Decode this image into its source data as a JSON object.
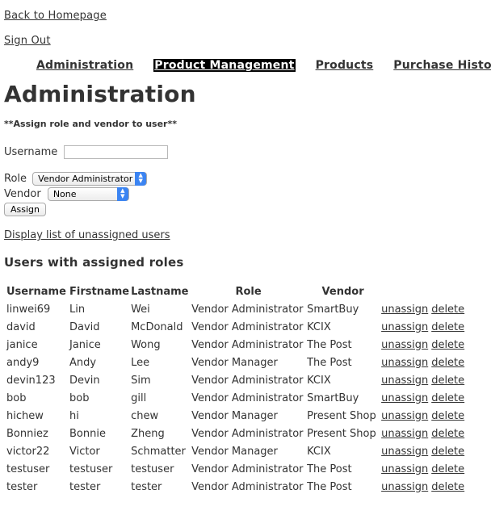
{
  "top_links": {
    "back": "Back to Homepage",
    "sign_out": "Sign Out"
  },
  "nav": {
    "items": [
      {
        "label": "Administration",
        "active": false
      },
      {
        "label": "Product Management",
        "active": true
      },
      {
        "label": "Products",
        "active": false
      },
      {
        "label": "Purchase History",
        "active": false
      }
    ]
  },
  "page": {
    "title": "Administration",
    "subtitle": "**Assign role and vendor to user**",
    "unassigned_link": "Display list of unassigned users",
    "section_title": "Users with assigned roles"
  },
  "form": {
    "username_label": "Username",
    "username_value": "",
    "role_label": "Role",
    "role_value": "Vendor Administrator",
    "vendor_label": "Vendor",
    "vendor_value": "None",
    "assign_label": "Assign"
  },
  "table": {
    "headers": [
      "Username",
      "Firstname",
      "Lastname",
      "Role",
      "Vendor"
    ],
    "action_labels": {
      "unassign": "unassign",
      "delete": "delete"
    },
    "rows": [
      {
        "username": "linwei69",
        "firstname": "Lin",
        "lastname": "Wei",
        "role": "Vendor Administrator",
        "vendor": "SmartBuy"
      },
      {
        "username": "david",
        "firstname": "David",
        "lastname": "McDonald",
        "role": "Vendor Administrator",
        "vendor": "KCIX"
      },
      {
        "username": "janice",
        "firstname": "Janice",
        "lastname": "Wong",
        "role": "Vendor Administrator",
        "vendor": "The Post"
      },
      {
        "username": "andy9",
        "firstname": "Andy",
        "lastname": "Lee",
        "role": "Vendor Manager",
        "vendor": "The Post"
      },
      {
        "username": "devin123",
        "firstname": "Devin",
        "lastname": "Sim",
        "role": "Vendor Administrator",
        "vendor": "KCIX"
      },
      {
        "username": "bob",
        "firstname": "bob",
        "lastname": "gill",
        "role": "Vendor Administrator",
        "vendor": "SmartBuy"
      },
      {
        "username": "hichew",
        "firstname": "hi",
        "lastname": "chew",
        "role": "Vendor Manager",
        "vendor": "Present Shop"
      },
      {
        "username": "Bonniez",
        "firstname": "Bonnie",
        "lastname": "Zheng",
        "role": "Vendor Administrator",
        "vendor": "Present Shop"
      },
      {
        "username": "victor22",
        "firstname": "Victor",
        "lastname": "Schmatter",
        "role": "Vendor Manager",
        "vendor": "KCIX"
      },
      {
        "username": "testuser",
        "firstname": "testuser",
        "lastname": "testuser",
        "role": "Vendor Administrator",
        "vendor": "The Post"
      },
      {
        "username": "tester",
        "firstname": "tester",
        "lastname": "tester",
        "role": "Vendor Administrator",
        "vendor": "The Post"
      }
    ]
  }
}
